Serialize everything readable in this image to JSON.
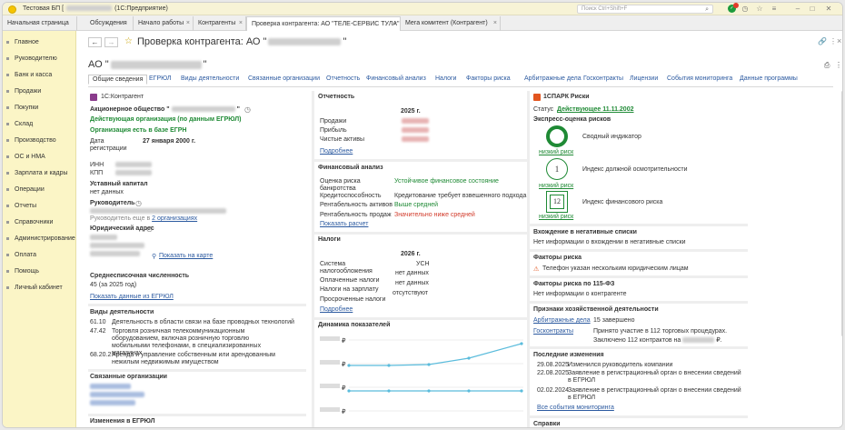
{
  "titlebar": {
    "title": "Тестовая БП [",
    "app": "(1С:Предприятие)",
    "search_placeholder": "Поиск Ctrl+Shift+F"
  },
  "tabs": [
    "Начальная страница",
    "Обсуждения",
    "Начало работы",
    "Контрагенты",
    "Проверка контрагента: АО \"ТЕЛЕ-СЕРВИС ТУЛА\"",
    "Мега комитент (Контрагент)"
  ],
  "sidebar": [
    "Главное",
    "Руководителю",
    "Банк и касса",
    "Продажи",
    "Покупки",
    "Склад",
    "Производство",
    "ОС и НМА",
    "Зарплата и кадры",
    "Операции",
    "Отчеты",
    "Справочники",
    "Администрирование",
    "Оплата",
    "Помощь",
    "Личный кабинет"
  ],
  "page": {
    "title_prefix": "Проверка контрагента: АО \"",
    "title_suffix": "\"",
    "org_prefix": "АО \"",
    "org_suffix": "\""
  },
  "subtabs": [
    "Общие сведения",
    "ЕГРЮЛ",
    "Виды деятельности",
    "Связанные организации",
    "Отчетность",
    "Финансовый анализ",
    "Налоги",
    "Факторы риска",
    "Арбитражные дела",
    "Госконтракты",
    "Лицензии",
    "События мониторинга",
    "Данные программы"
  ],
  "left": {
    "kontragent": "1С:Контрагент",
    "jsc": "Акционерное общество \"",
    "jsc_end": "\"",
    "active": "Действующая организация (по данным ЕГРЮЛ)",
    "in_egrn": "Организация есть в базе ЕГРН",
    "reg_label": "Дата регистрации",
    "reg_value": "27 января 2000 г.",
    "inn": "ИНН",
    "kpp": "КПП",
    "capital_label": "Уставный капитал",
    "capital_value": "нет данных",
    "head_label": "Руководитель",
    "head_more_prefix": "Руководитель еще в",
    "head_more_link": "2 организациях",
    "addr_label": "Юридический адрес",
    "map_link": "Показать на карте",
    "staff_label": "Среднесписочная численность",
    "staff_value": "45 (за 2025 год)",
    "egrul_link": "Показать данные из ЕГРЮЛ",
    "activities_label": "Виды деятельности",
    "activities": [
      {
        "code": "61.10",
        "text": "Деятельность в области связи на базе проводных технологий"
      },
      {
        "code": "47.42",
        "text": "Торговля розничная телекоммуникационным оборудованием, включая розничную торговлю мобильными телефонами, в специализированных магазинах"
      },
      {
        "code": "68.20.2",
        "text": "Аренда и управление собственным или арендованным нежилым недвижимым имуществом"
      }
    ],
    "related_label": "Связанные организации",
    "changes_label": "Изменения в ЕГРЮЛ"
  },
  "mid": {
    "reporting_label": "Отчетность",
    "year": "2025 г.",
    "rows": [
      "Продажи",
      "Прибыль",
      "Чистые активы"
    ],
    "more": "Подробнее",
    "fin_label": "Финансовый анализ",
    "fin_rows": [
      {
        "k": "Оценка риска банкротства",
        "v": "Устойчивое финансовое состояние",
        "c": "grn"
      },
      {
        "k": "Кредитоспособность",
        "v": "Кредитование требует взвешенного подхода",
        "c": ""
      },
      {
        "k": "Рентабельность активов",
        "v": "Выше средней",
        "c": "grn"
      },
      {
        "k": "Рентабельность продаж",
        "v": "Значительно ниже средней",
        "c": "red"
      }
    ],
    "fin_link": "Показать расчет",
    "tax_label": "Налоги",
    "tax_year": "2026 г.",
    "tax_rows": [
      {
        "k": "Система налогообложения",
        "v": "УСН"
      },
      {
        "k": "Оплаченные налоги",
        "v": "нет данных"
      },
      {
        "k": "Налоги на зарплату",
        "v": "нет данных"
      },
      {
        "k": "Просроченные налоги",
        "v": "отсутствуют"
      }
    ],
    "tax_more": "Подробнее",
    "dyn_label": "Динамика показателей",
    "rub": "₽"
  },
  "right": {
    "spark_label": "1СПАРК Риски",
    "status_label": "Статус",
    "status_value": "Действующее 11.11.2002",
    "express": "Экспресс-оценка рисков",
    "risk_rows": [
      {
        "name": "Сводный индикатор",
        "level": "низкий риск",
        "glyph": ""
      },
      {
        "name": "Индекс должной осмотрительности",
        "level": "низкий риск",
        "glyph": "1"
      },
      {
        "name": "Индекс финансового риска",
        "level": "низкий риск",
        "glyph": "12"
      }
    ],
    "neg_label": "Вхождение в негативные списки",
    "neg_value": "Нет информации о вхождении в негативные списки",
    "factors_label": "Факторы риска",
    "factors_value": "Телефон указан нескольким юридическим лицам",
    "f115_label": "Факторы риска по 115-ФЗ",
    "f115_value": "Нет информации о контрагенте",
    "activity_label": "Признаки хозяйственной деятельности",
    "arb_link": "Арбитражные дела",
    "arb_value": "15 завершено",
    "gos_link": "Госконтракты",
    "gos_value_1": "Принято участие в 112 торговых процедурах.",
    "gos_value_2": "Заключено 112 контрактов на",
    "gos_value_3": "₽.",
    "changes_label": "Последние изменения",
    "changes": [
      {
        "date": "29.08.2025",
        "text": "Изменился руководитель компании"
      },
      {
        "date": "22.08.2025",
        "text": "Заявление в регистрационный орган о внесении сведений в ЕГРЮЛ"
      },
      {
        "date": "02.02.2024",
        "text": "Заявление в регистрационный орган о внесении сведений в ЕГРЮЛ"
      }
    ],
    "all_events": "Все события мониторинга",
    "bottom": "Справки"
  },
  "colors": {
    "green": "#1f8a35",
    "red": "#d23b2b",
    "link": "#2c5aa0",
    "sidebar": "#fbf5c6"
  }
}
